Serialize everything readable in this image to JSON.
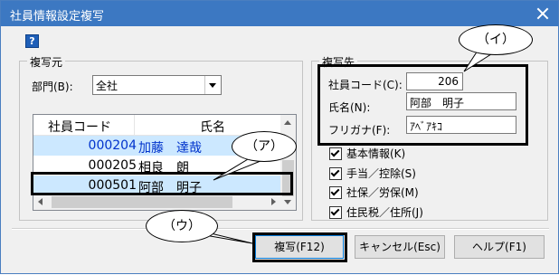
{
  "window": {
    "title": "社員情報設定複写",
    "help_symbol": "?"
  },
  "source_group": {
    "title": "複写元",
    "department_label": "部門(B):",
    "department_value": "全社",
    "list": {
      "columns": [
        "社員コード",
        "氏名"
      ],
      "rows": [
        {
          "code": "000204",
          "name": "加藤　達哉"
        },
        {
          "code": "000205",
          "name": "相良　朗"
        },
        {
          "code": "000501",
          "name": "阿部　明子"
        }
      ]
    }
  },
  "dest_group": {
    "title": "複写先",
    "code_label": "社員コード(C):",
    "code_value": "206",
    "name_label": "氏名(N):",
    "name_value": "阿部　明子",
    "kana_label": "フリガナ(F):",
    "kana_value": "ｱﾍﾞｱｷｺ"
  },
  "options": [
    {
      "label": "基本情報(K)",
      "checked": true
    },
    {
      "label": "手当／控除(S)",
      "checked": true
    },
    {
      "label": "社保／労保(M)",
      "checked": true
    },
    {
      "label": "住民税／住所(J)",
      "checked": true
    }
  ],
  "buttons": {
    "copy": "複写(F12)",
    "cancel": "キャンセル(Esc)",
    "help": "ヘルプ(F1)"
  },
  "callouts": {
    "a": "（ア）",
    "i": "（イ）",
    "u": "（ウ）"
  }
}
